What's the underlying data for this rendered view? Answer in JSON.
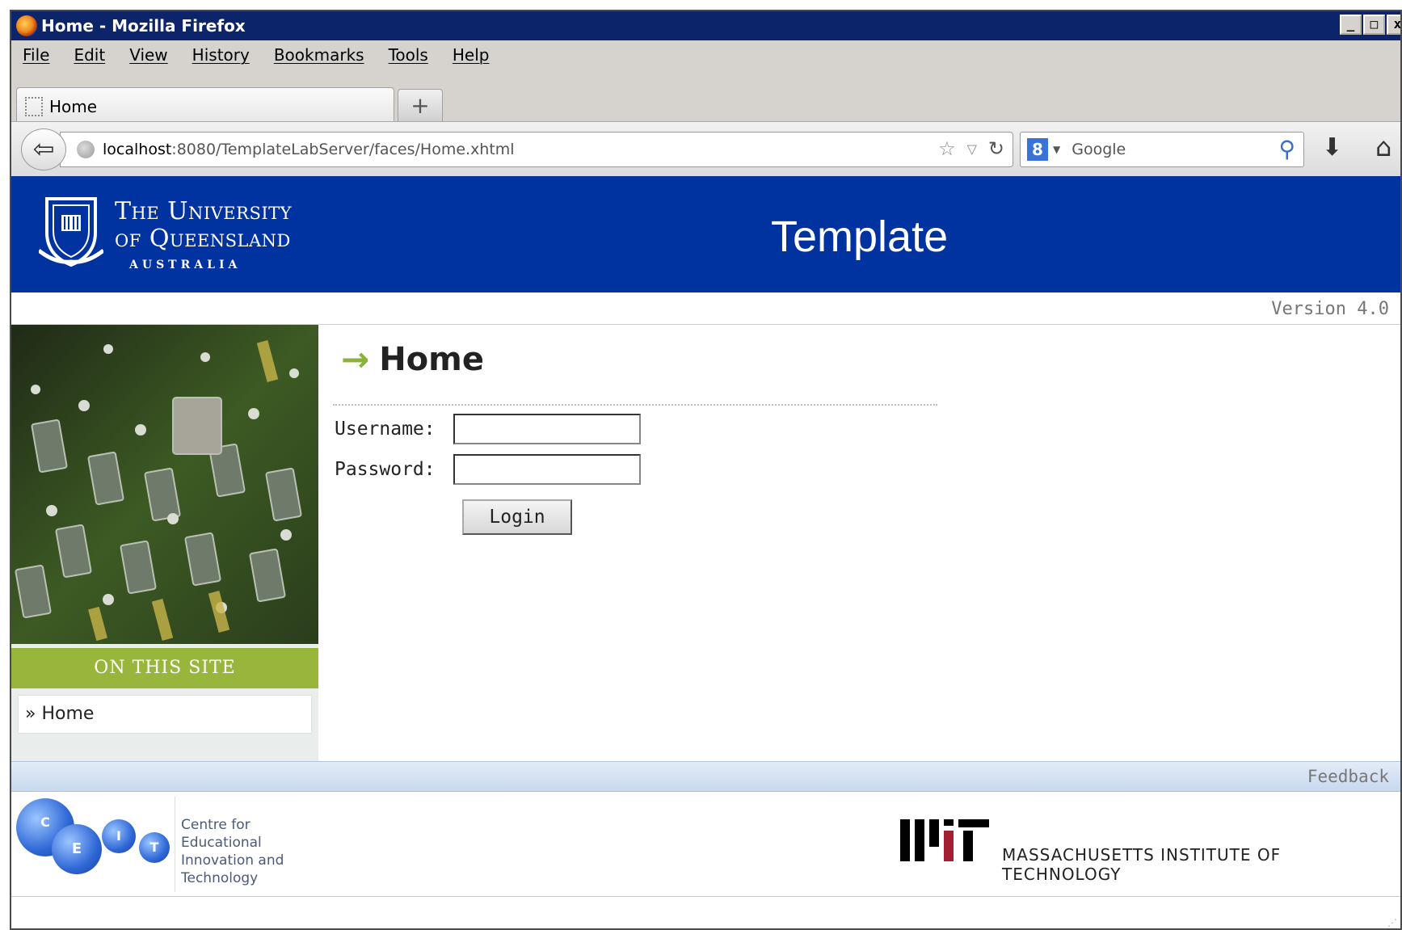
{
  "window": {
    "title": "Home - Mozilla Firefox",
    "minimize": "_",
    "maximize": "□",
    "close": "x"
  },
  "menu": [
    "File",
    "Edit",
    "View",
    "History",
    "Bookmarks",
    "Tools",
    "Help"
  ],
  "tab": {
    "label": "Home",
    "new_tab": "+"
  },
  "nav": {
    "url_host": "localhost",
    "url_path": ":8080/TemplateLabServer/faces/Home.xhtml",
    "search_placeholder": "Google",
    "search_engine_icon": "8"
  },
  "header": {
    "uq_line1": "The University",
    "uq_line2": "of Queensland",
    "uq_line3": "AUSTRALIA",
    "title": "Template"
  },
  "version": "Version 4.0",
  "sidebar": {
    "section_title": "ON THIS SITE",
    "items": [
      "» Home"
    ]
  },
  "main": {
    "heading": "Home",
    "username_label": "Username:",
    "password_label": "Password:",
    "username_value": "",
    "password_value": "",
    "login_label": "Login"
  },
  "feedback": "Feedback",
  "footer": {
    "ceit_letters": [
      "C",
      "E",
      "I",
      "T"
    ],
    "ceit_line1": "Centre for",
    "ceit_line2": "Educational",
    "ceit_line3": "Innovation and",
    "ceit_line4": "Technology",
    "mit_name": "MASSACHUSETTS INSTITUTE OF TECHNOLOGY"
  },
  "colors": {
    "uq_blue": "#0032a0",
    "accent_green": "#98b53c",
    "title_bar": "#0c246a"
  }
}
